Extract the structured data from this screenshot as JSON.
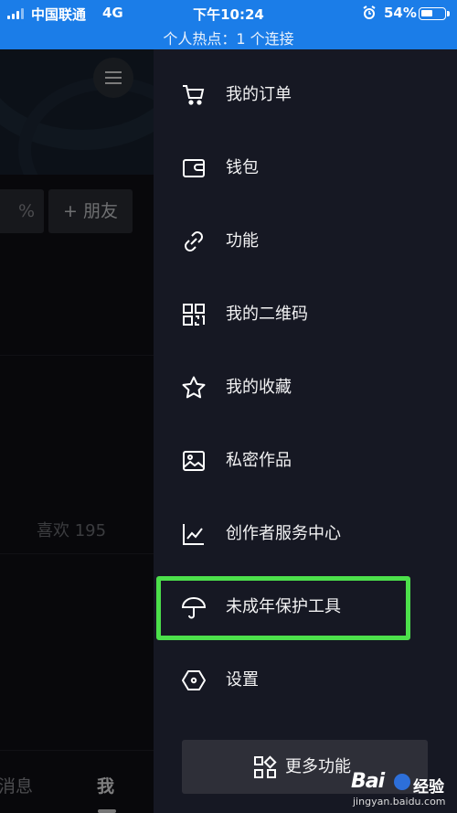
{
  "status_bar": {
    "carrier": "中国联通",
    "network": "4G",
    "time": "下午10:24",
    "alarm_icon": "alarm-clock-icon",
    "battery_percent": "54%",
    "battery_level": 0.54,
    "hotspot_text": "个人热点：1 个连接",
    "bar_color": "#1b7de8"
  },
  "profile_bg": {
    "partial_button_label": "%",
    "friend_button_label": "+ 朋友",
    "likes_text": "喜欢 195",
    "tabs": {
      "messages": "消息",
      "me": "我"
    }
  },
  "drawer": {
    "items": [
      {
        "label": "我的订单",
        "icon": "shopping-cart-icon"
      },
      {
        "label": "钱包",
        "icon": "wallet-icon"
      },
      {
        "label": "功能",
        "icon": "link-icon"
      },
      {
        "label": "我的二维码",
        "icon": "qr-code-icon"
      },
      {
        "label": "我的收藏",
        "icon": "star-icon"
      },
      {
        "label": "私密作品",
        "icon": "image-icon"
      },
      {
        "label": "创作者服务中心",
        "icon": "chart-line-icon"
      },
      {
        "label": "未成年保护工具",
        "icon": "umbrella-icon"
      },
      {
        "label": "设置",
        "icon": "hexagon-settings-icon"
      }
    ],
    "more_button_label": "更多功能",
    "more_button_icon": "grid-icon"
  },
  "highlight_color": "#4ce04b",
  "watermark": {
    "logo": "Bai",
    "brand_suffix": "经验",
    "url": "jingyan.baidu.com"
  }
}
